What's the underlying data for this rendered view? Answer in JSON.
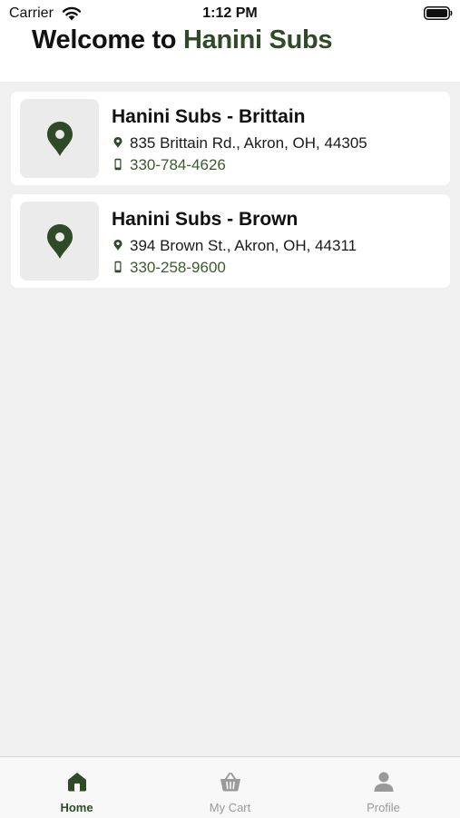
{
  "status_bar": {
    "carrier": "Carrier",
    "time": "1:12 PM"
  },
  "header": {
    "title_prefix": "Welcome to ",
    "title_accent": "Hanini Subs"
  },
  "colors": {
    "brand": "#2f4a26",
    "phone_text": "#3d5a2f",
    "background": "#f0f0f0"
  },
  "stores": [
    {
      "name": "Hanini Subs - Brittain",
      "address": "835 Brittain Rd., Akron, OH, 44305",
      "phone": "330-784-4626",
      "icon": "map-pin-icon"
    },
    {
      "name": "Hanini Subs - Brown",
      "address": "394 Brown St., Akron, OH, 44311",
      "phone": "330-258-9600",
      "icon": "map-pin-icon"
    }
  ],
  "tabbar": {
    "tabs": [
      {
        "label": "Home",
        "icon": "home-icon",
        "active": true
      },
      {
        "label": "My Cart",
        "icon": "basket-icon",
        "active": false
      },
      {
        "label": "Profile",
        "icon": "person-icon",
        "active": false
      }
    ]
  }
}
